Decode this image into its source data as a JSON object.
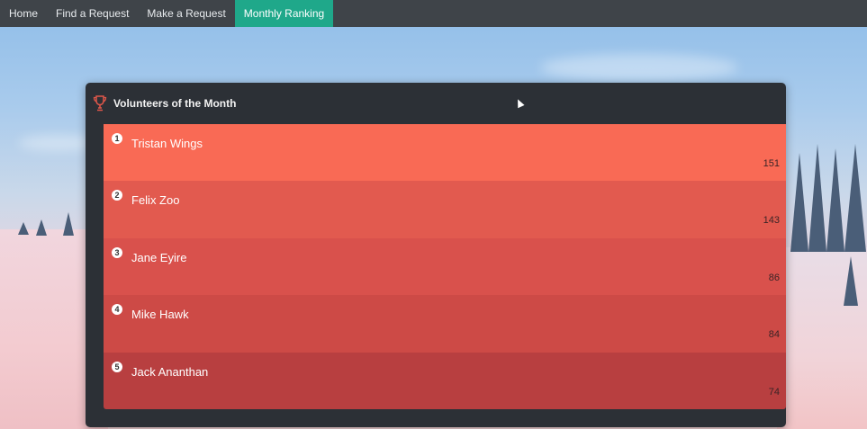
{
  "nav": {
    "items": [
      {
        "label": "Home",
        "active": false
      },
      {
        "label": "Find a Request",
        "active": false
      },
      {
        "label": "Make a Request",
        "active": false
      },
      {
        "label": "Monthly Ranking",
        "active": true
      }
    ]
  },
  "ranking": {
    "title": "Volunteers of the Month",
    "rows": [
      {
        "rank": "1",
        "name": "Tristan Wings",
        "points": "151",
        "color": "#f96a55"
      },
      {
        "rank": "2",
        "name": "Felix Zoo",
        "points": "143",
        "color": "#e25a4f"
      },
      {
        "rank": "3",
        "name": "Jane Eyire",
        "points": "86",
        "color": "#d9514c"
      },
      {
        "rank": "4",
        "name": "Mike Hawk",
        "points": "84",
        "color": "#cd4a46"
      },
      {
        "rank": "5",
        "name": "Jack Ananthan",
        "points": "74",
        "color": "#b83f40"
      }
    ]
  },
  "colors": {
    "nav_bg": "#3f4449",
    "nav_active": "#1fa88a",
    "card_bg": "#2c3036",
    "trophy": "#e0574a"
  }
}
